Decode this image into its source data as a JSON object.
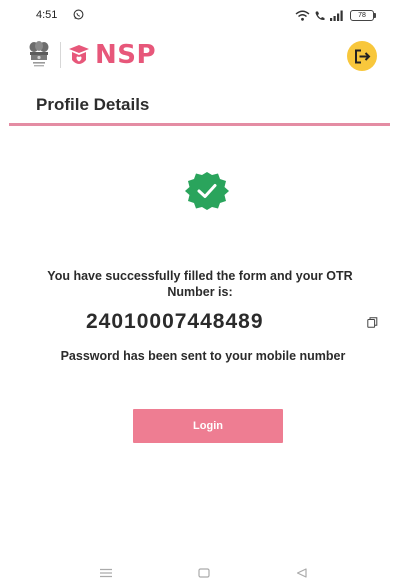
{
  "status_bar": {
    "time": "4:51",
    "battery": "78"
  },
  "header": {
    "brand": "NSP",
    "brand_color": "#e7577a",
    "logout_color": "#f8c73c"
  },
  "profile": {
    "title": "Profile Details",
    "success_message": "You have successfully filled the form and your OTR Number is:",
    "otr_number": "24010007448489",
    "password_message": "Password has been sent to your mobile number",
    "login_label": "Login",
    "login_color": "#ee7d92",
    "success_color": "#2aa45c"
  },
  "icons": {
    "status": [
      "whatsapp-icon",
      "wifi-icon",
      "volte-call-icon",
      "signal-icon",
      "battery-icon"
    ],
    "header": [
      "national-emblem-icon",
      "nsp-logo-icon",
      "logout-icon"
    ],
    "content": [
      "check-badge-icon",
      "copy-icon"
    ],
    "navigation": [
      "menu-icon",
      "home-icon",
      "back-icon"
    ]
  }
}
